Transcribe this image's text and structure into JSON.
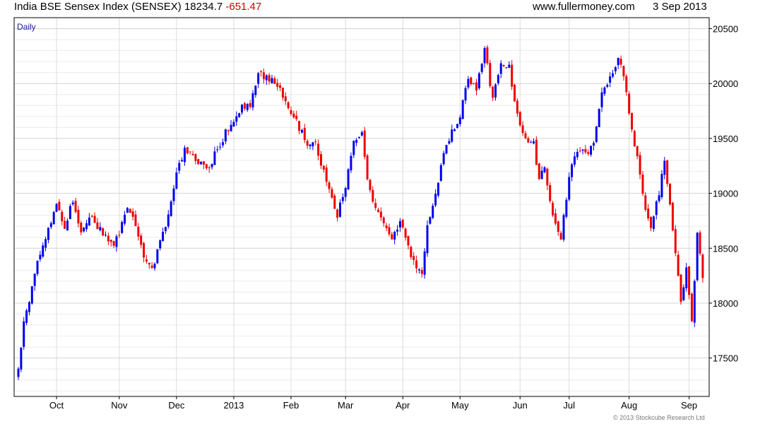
{
  "header": {
    "title": "India BSE Sensex Index (SENSEX) 18234.7",
    "change": "-651.47",
    "site": "www.fullermoney.com",
    "date": "3 Sep 2013"
  },
  "footer": {
    "copyright": "© 2013 Stockcube Research Ltd"
  },
  "colors": {
    "up": "#0000ee",
    "down": "#ee0000",
    "grid": "#d4d4d4",
    "axis": "#000000",
    "label": "#1a1aa0"
  },
  "chart_data": {
    "type": "candlestick",
    "period_label": "Daily",
    "ylim": [
      17150,
      20600
    ],
    "y_ticks": [
      17500,
      18000,
      18500,
      19000,
      19500,
      20000,
      20500
    ],
    "x_tick_labels": [
      "Oct",
      "Nov",
      "Dec",
      "2013",
      "Feb",
      "Mar",
      "Apr",
      "May",
      "Jun",
      "Jul",
      "Aug",
      "Sep"
    ],
    "x_tick_index": [
      14,
      37,
      58,
      79,
      100,
      120,
      141,
      162,
      184,
      202,
      224,
      246
    ],
    "y_axis_side": "right",
    "grid": true,
    "series": [
      {
        "name": "India BSE Sensex Index (SENSEX)"
      }
    ],
    "close_path": [
      [
        0,
        17370
      ],
      [
        2,
        17850
      ],
      [
        4,
        18000
      ],
      [
        6,
        18300
      ],
      [
        9,
        18500
      ],
      [
        12,
        18750
      ],
      [
        14,
        18900
      ],
      [
        17,
        18700
      ],
      [
        20,
        18950
      ],
      [
        23,
        18650
      ],
      [
        26,
        18800
      ],
      [
        29,
        18700
      ],
      [
        32,
        18600
      ],
      [
        35,
        18500
      ],
      [
        37,
        18650
      ],
      [
        40,
        18900
      ],
      [
        43,
        18700
      ],
      [
        46,
        18400
      ],
      [
        49,
        18300
      ],
      [
        52,
        18550
      ],
      [
        55,
        18800
      ],
      [
        58,
        19200
      ],
      [
        61,
        19400
      ],
      [
        63,
        19350
      ],
      [
        66,
        19300
      ],
      [
        69,
        19200
      ],
      [
        72,
        19350
      ],
      [
        76,
        19550
      ],
      [
        79,
        19650
      ],
      [
        82,
        19800
      ],
      [
        85,
        19800
      ],
      [
        88,
        20100
      ],
      [
        91,
        20050
      ],
      [
        94,
        20000
      ],
      [
        97,
        19900
      ],
      [
        100,
        19750
      ],
      [
        103,
        19600
      ],
      [
        106,
        19450
      ],
      [
        109,
        19450
      ],
      [
        112,
        19200
      ],
      [
        115,
        18950
      ],
      [
        117,
        18800
      ],
      [
        120,
        19050
      ],
      [
        123,
        19450
      ],
      [
        126,
        19550
      ],
      [
        128,
        19100
      ],
      [
        131,
        18850
      ],
      [
        134,
        18700
      ],
      [
        137,
        18600
      ],
      [
        140,
        18750
      ],
      [
        143,
        18500
      ],
      [
        146,
        18300
      ],
      [
        148,
        18250
      ],
      [
        150,
        18700
      ],
      [
        153,
        19000
      ],
      [
        156,
        19350
      ],
      [
        159,
        19550
      ],
      [
        162,
        19700
      ],
      [
        165,
        20050
      ],
      [
        168,
        19950
      ],
      [
        171,
        20300
      ],
      [
        174,
        19850
      ],
      [
        177,
        20200
      ],
      [
        180,
        20150
      ],
      [
        183,
        19700
      ],
      [
        186,
        19500
      ],
      [
        189,
        19450
      ],
      [
        191,
        19100
      ],
      [
        193,
        19250
      ],
      [
        195,
        18950
      ],
      [
        197,
        18700
      ],
      [
        199,
        18600
      ],
      [
        202,
        19150
      ],
      [
        205,
        19400
      ],
      [
        208,
        19350
      ],
      [
        211,
        19450
      ],
      [
        214,
        19900
      ],
      [
        217,
        20050
      ],
      [
        220,
        20250
      ],
      [
        222,
        20100
      ],
      [
        224,
        19700
      ],
      [
        226,
        19450
      ],
      [
        228,
        19200
      ],
      [
        230,
        18850
      ],
      [
        232,
        18700
      ],
      [
        235,
        19000
      ],
      [
        237,
        19300
      ],
      [
        239,
        18900
      ],
      [
        241,
        18450
      ],
      [
        243,
        18000
      ],
      [
        245,
        18300
      ],
      [
        247,
        17800
      ],
      [
        249,
        18650
      ],
      [
        251,
        18234.7
      ]
    ]
  }
}
